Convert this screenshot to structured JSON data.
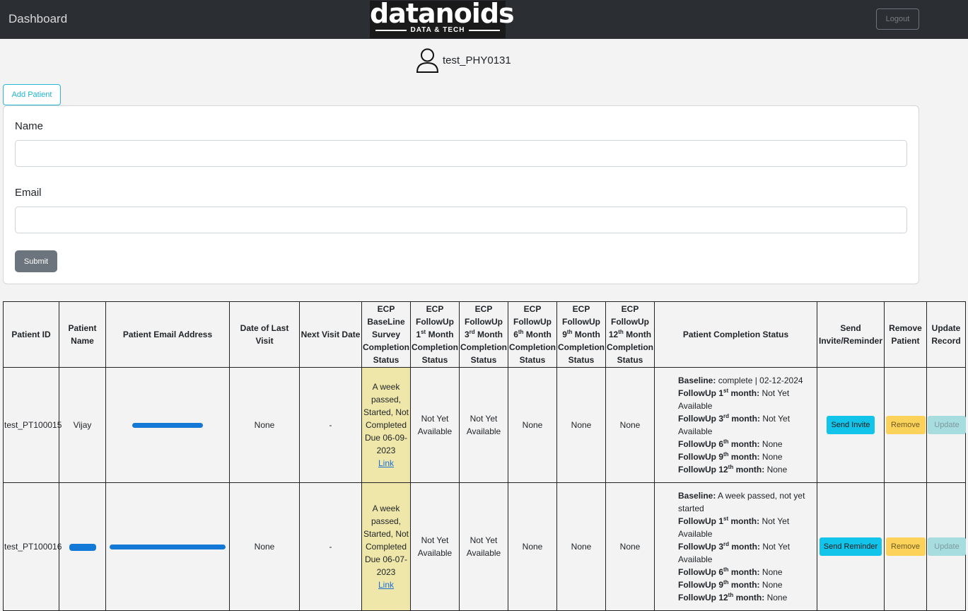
{
  "nav": {
    "brand": "Dashboard",
    "logo_word": "datanoids",
    "logo_tagline": "DATA & TECH",
    "logout_label": "Logout"
  },
  "user": {
    "name": "test_PHY0131",
    "icon": "user-icon"
  },
  "add_patient_label": "Add Patient",
  "form": {
    "name_label": "Name",
    "name_value": "",
    "name_placeholder": "",
    "email_label": "Email",
    "email_value": "",
    "email_placeholder": "",
    "submit_label": "Submit"
  },
  "table": {
    "headers": [
      "Patient ID",
      "Patient Name",
      "Patient Email Address",
      "Date of Last Visit",
      "Next Visit Date",
      "ECP BaseLine Survey Completion Status",
      "ECP FollowUp 1st Month Completion Status",
      "ECP FollowUp 3rd Month Completion Status",
      "ECP FollowUp 6th Month Completion Status",
      "ECP FollowUp 9th Month Completion Status",
      "ECP FollowUp 12th Month Completion Status",
      "Patient Completion Status",
      "Send Invite/Reminder",
      "Remove Patient",
      "Update Record"
    ],
    "rows": [
      {
        "id": "test_PT100015",
        "name": "Vijay",
        "email": "",
        "last_visit": "None",
        "next_visit": "-",
        "baseline": "A week passed, Started, Not Completed Due 06-09-2023",
        "baseline_link": "Link",
        "fu1": "Not Yet Available",
        "fu3": "Not Yet Available",
        "fu6": "None",
        "fu9": "None",
        "fu12": "None",
        "status": [
          {
            "label": "Baseline:",
            "value": "complete | 02-12-2024"
          },
          {
            "label": "FollowUp 1st month:",
            "value": "Not Yet Available"
          },
          {
            "label": "FollowUp 3rd month:",
            "value": "Not Yet Available"
          },
          {
            "label": "FollowUp 6th month:",
            "value": "None"
          },
          {
            "label": "FollowUp 9th month:",
            "value": "None"
          },
          {
            "label": "FollowUp 12th month:",
            "value": "None"
          }
        ],
        "send_label": "Send Invite",
        "remove_label": "Remove",
        "update_label": "Update"
      },
      {
        "id": "test_PT100016",
        "name": "",
        "email": "",
        "last_visit": "None",
        "next_visit": "-",
        "baseline": "A week passed, Started, Not Completed Due 06-07-2023",
        "baseline_link": "Link",
        "fu1": "Not Yet Available",
        "fu3": "Not Yet Available",
        "fu6": "None",
        "fu9": "None",
        "fu12": "None",
        "status": [
          {
            "label": "Baseline:",
            "value": "A week passed, not yet started"
          },
          {
            "label": "FollowUp 1st month:",
            "value": "Not Yet Available"
          },
          {
            "label": "FollowUp 3rd month:",
            "value": "Not Yet Available"
          },
          {
            "label": "FollowUp 6th month:",
            "value": "None"
          },
          {
            "label": "FollowUp 9th month:",
            "value": "None"
          },
          {
            "label": "FollowUp 12th month:",
            "value": "None"
          }
        ],
        "send_label": "Send Reminder",
        "remove_label": "Remove",
        "update_label": "Update"
      }
    ]
  },
  "colors": {
    "navbar": "#2b2e32",
    "info": "#13c4ea",
    "warning": "#fcd25a",
    "due_highlight": "#efe7aa",
    "redaction": "#1478d6"
  }
}
